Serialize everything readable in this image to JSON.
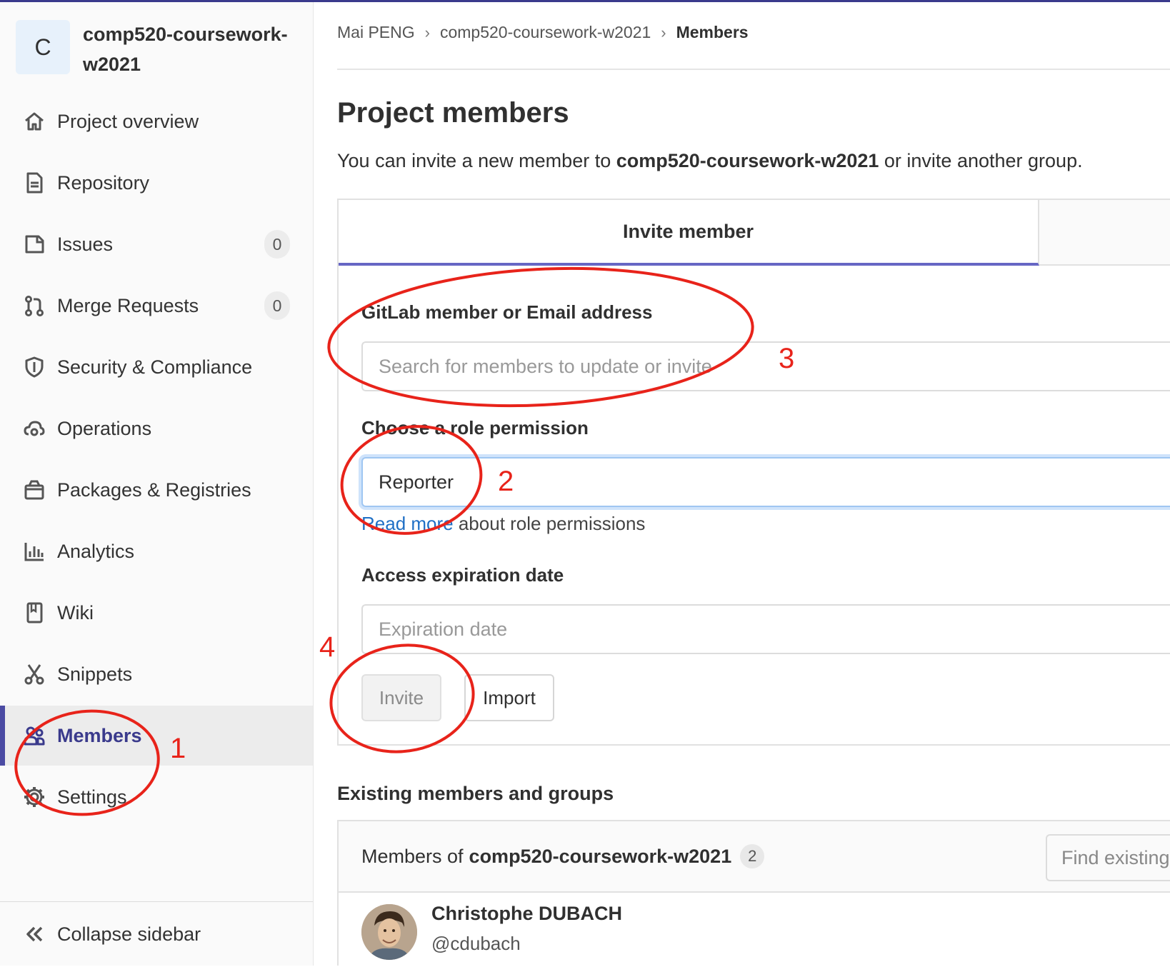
{
  "project": {
    "avatar_letter": "C",
    "name": "comp520-coursework-w2021"
  },
  "sidebar": {
    "items": [
      {
        "label": "Project overview",
        "icon": "home-icon"
      },
      {
        "label": "Repository",
        "icon": "document-icon"
      },
      {
        "label": "Issues",
        "icon": "issues-icon",
        "badge": "0"
      },
      {
        "label": "Merge Requests",
        "icon": "merge-request-icon",
        "badge": "0"
      },
      {
        "label": "Security & Compliance",
        "icon": "shield-icon"
      },
      {
        "label": "Operations",
        "icon": "cloud-gear-icon"
      },
      {
        "label": "Packages & Registries",
        "icon": "package-icon"
      },
      {
        "label": "Analytics",
        "icon": "chart-icon"
      },
      {
        "label": "Wiki",
        "icon": "book-icon"
      },
      {
        "label": "Snippets",
        "icon": "scissors-icon"
      },
      {
        "label": "Members",
        "icon": "users-icon",
        "active": true
      },
      {
        "label": "Settings",
        "icon": "gear-icon"
      }
    ],
    "collapse_label": "Collapse sidebar"
  },
  "breadcrumb": {
    "items": [
      "Mai PENG",
      "comp520-coursework-w2021",
      "Members"
    ]
  },
  "page": {
    "title": "Project members",
    "intro_prefix": "You can invite a new member to ",
    "intro_project": "comp520-coursework-w2021",
    "intro_suffix": " or invite another group."
  },
  "invite": {
    "tab_label": "Invite member",
    "member_label": "GitLab member or Email address",
    "member_placeholder": "Search for members to update or invite",
    "role_label": "Choose a role permission",
    "role_value": "Reporter",
    "help_link": "Read more",
    "help_text": " about role permissions",
    "expiration_label": "Access expiration date",
    "expiration_placeholder": "Expiration date",
    "invite_button": "Invite",
    "import_button": "Import"
  },
  "existing": {
    "title": "Existing members and groups",
    "members_of_prefix": "Members of",
    "project": "comp520-coursework-w2021",
    "count": "2",
    "find_placeholder": "Find existing",
    "members": [
      {
        "name": "Christophe DUBACH",
        "handle": "@cdubach"
      }
    ]
  },
  "annotations": {
    "color": "#e8231a",
    "labels": [
      "1",
      "2",
      "3",
      "4"
    ]
  },
  "colors": {
    "accent": "#4b4ba3",
    "link": "#1f6fc5",
    "tab_underline": "#6666c4"
  }
}
